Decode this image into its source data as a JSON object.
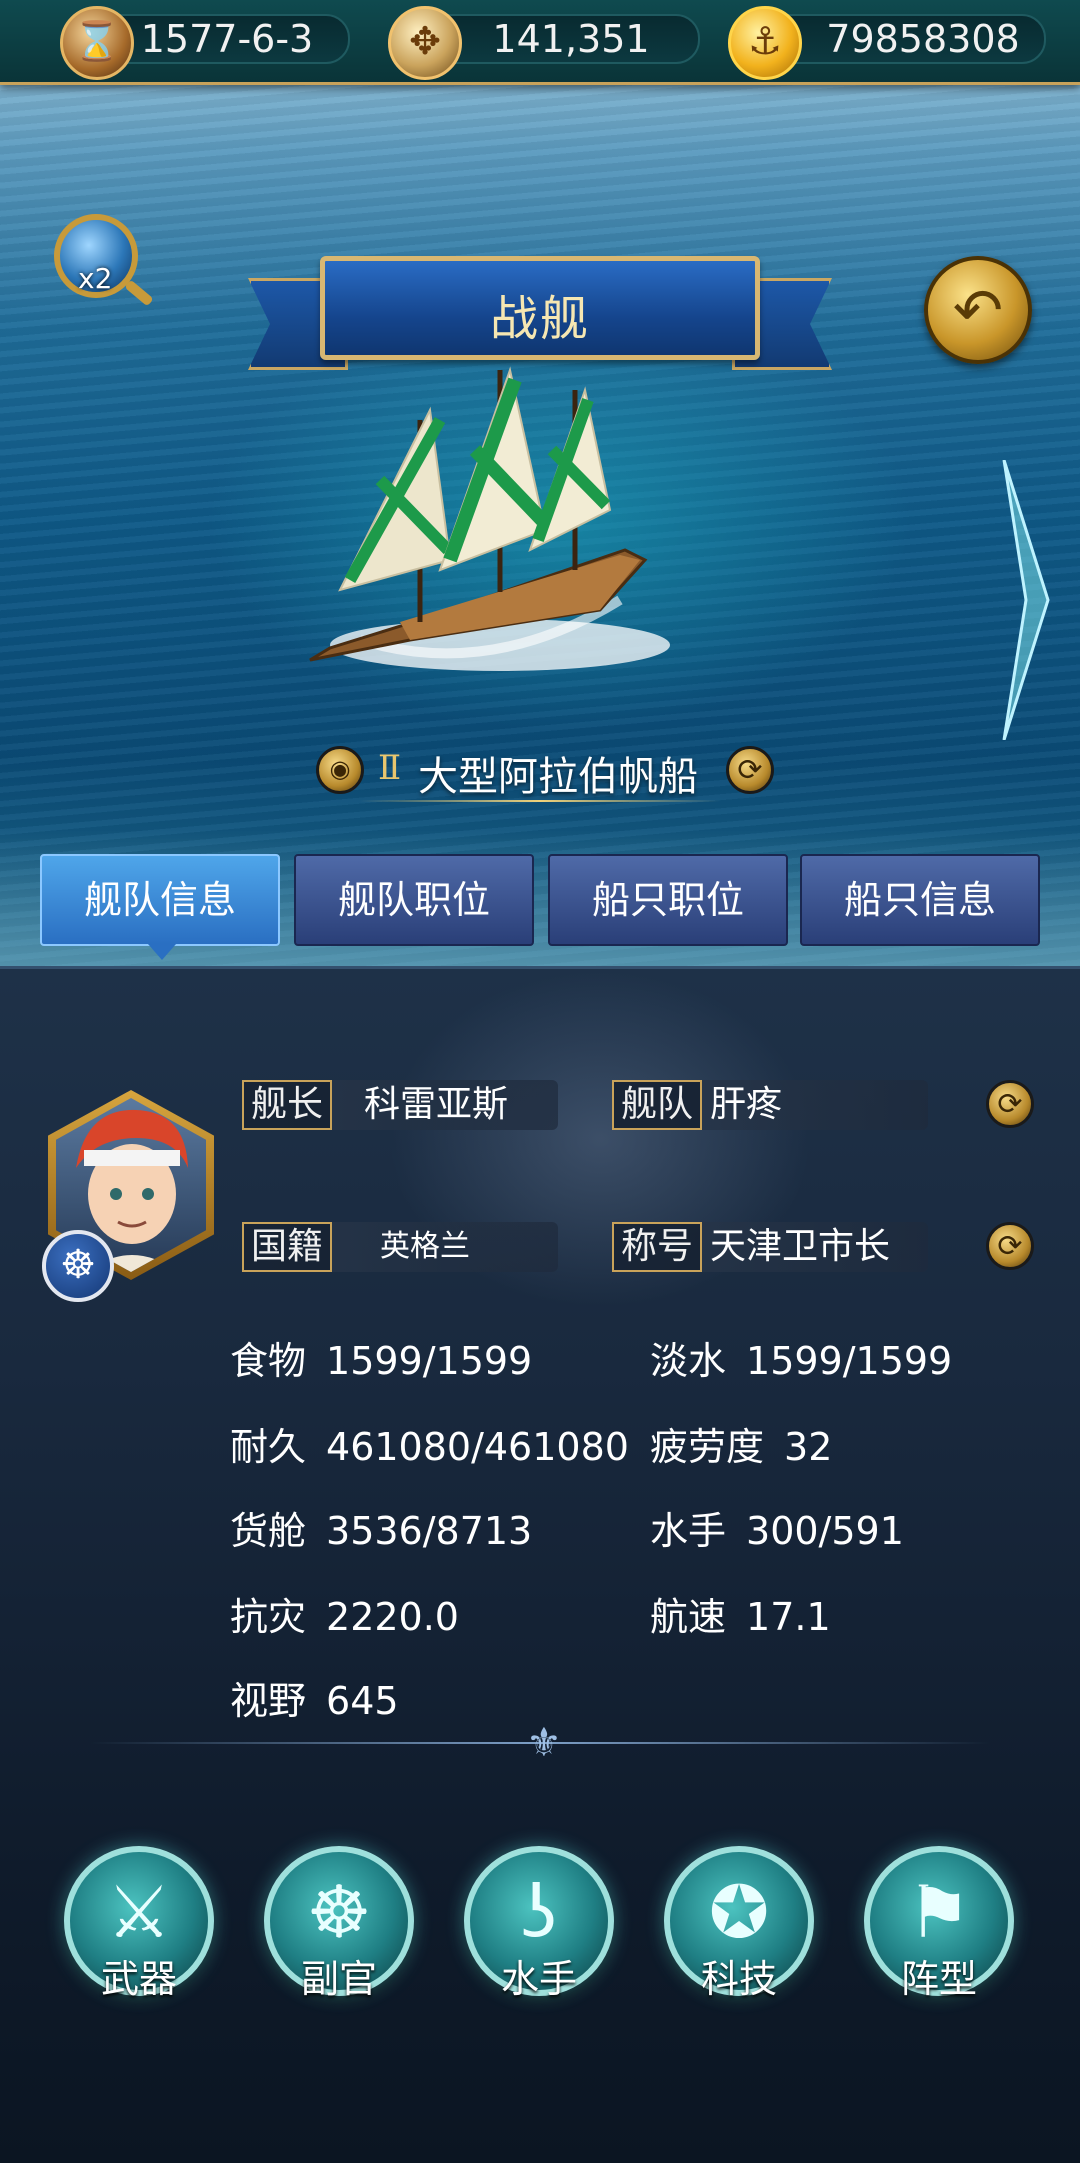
{
  "top_bar": {
    "date": "1577-6-3",
    "compass_value": "141,351",
    "gold": "79858308"
  },
  "header": {
    "zoom_label": "x2",
    "title": "战舰"
  },
  "ship": {
    "tier": "Ⅱ",
    "name": "大型阿拉伯帆船"
  },
  "tabs": [
    {
      "label": "舰队信息",
      "active": true
    },
    {
      "label": "舰队职位",
      "active": false
    },
    {
      "label": "船只职位",
      "active": false
    },
    {
      "label": "船只信息",
      "active": false
    }
  ],
  "captain": {
    "captain_label": "舰长",
    "captain_name": "科雷亚斯",
    "fleet_label": "舰队",
    "fleet_name": "肝疼",
    "nationality_label": "国籍",
    "nationality": "英格兰",
    "title_label": "称号",
    "title": "天津卫市长"
  },
  "stats": {
    "food": {
      "label": "食物",
      "value": "1599/1599"
    },
    "water": {
      "label": "淡水",
      "value": "1599/1599"
    },
    "durability": {
      "label": "耐久",
      "value": "461080/461080"
    },
    "fatigue": {
      "label": "疲劳度",
      "value": "32"
    },
    "cargo": {
      "label": "货舱",
      "value": "3536/8713"
    },
    "sailors": {
      "label": "水手",
      "value": "300/591"
    },
    "resistance": {
      "label": "抗灾",
      "value": "2220.0"
    },
    "speed": {
      "label": "航速",
      "value": "17.1"
    },
    "vision": {
      "label": "视野",
      "value": "645"
    }
  },
  "bottom_buttons": [
    {
      "label": "武器",
      "icon": "sword-icon"
    },
    {
      "label": "副官",
      "icon": "helm-icon"
    },
    {
      "label": "水手",
      "icon": "hook-icon"
    },
    {
      "label": "科技",
      "icon": "compass-icon"
    },
    {
      "label": "阵型",
      "icon": "flag-icon"
    }
  ],
  "colors": {
    "tab_active": "#3a8bd6",
    "tab_inactive": "#3b5190",
    "gold_trim": "#c9a35a",
    "button_teal": "#2a9c9c"
  }
}
